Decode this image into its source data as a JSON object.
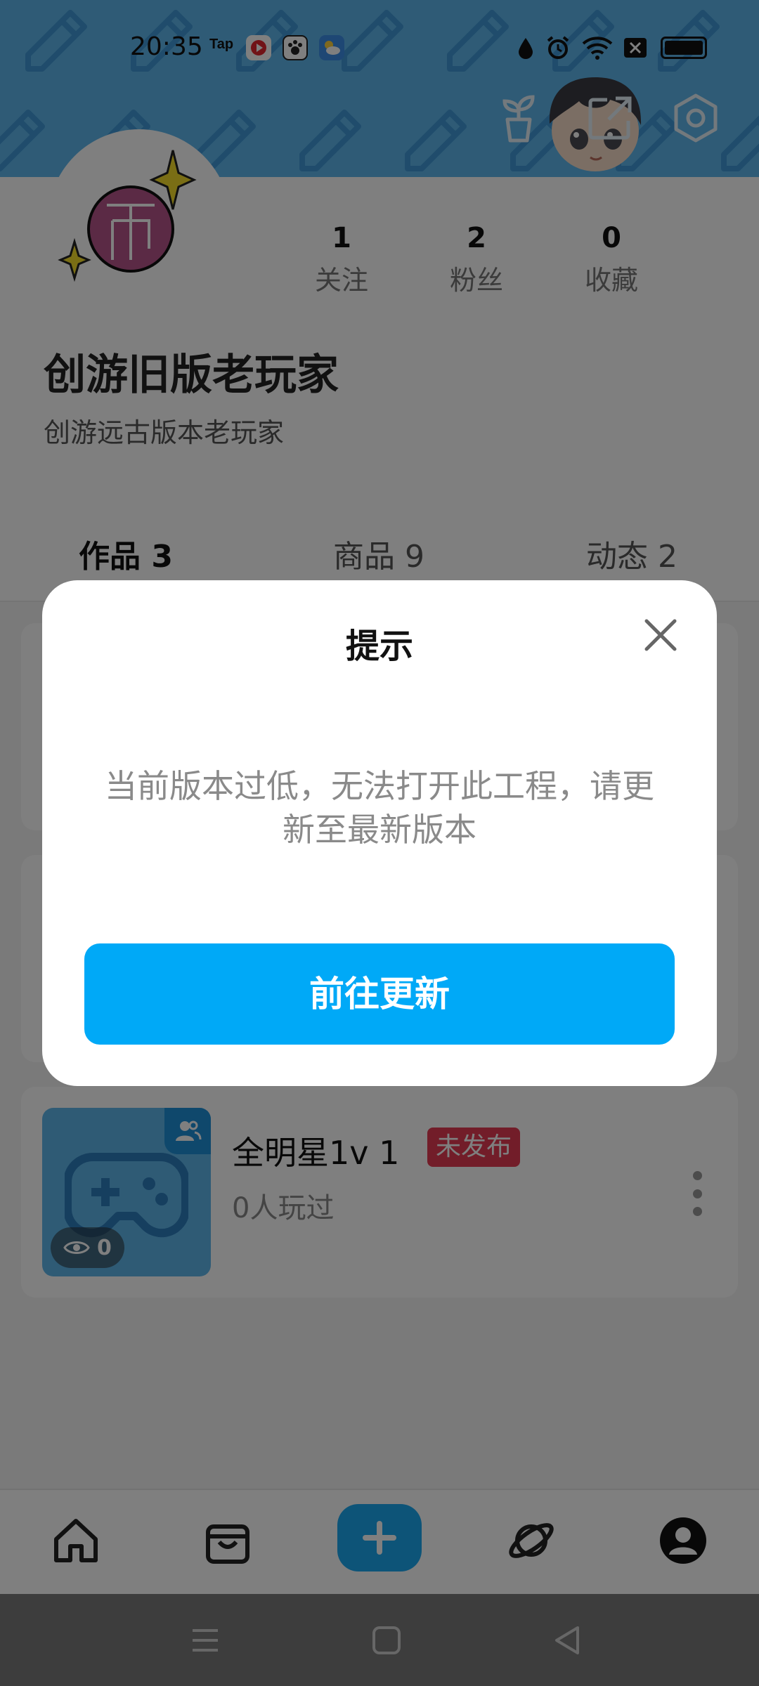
{
  "status_bar": {
    "time": "20:35",
    "tap_label": "Tap"
  },
  "profile": {
    "stats": [
      {
        "value": "1",
        "label": "关注"
      },
      {
        "value": "2",
        "label": "粉丝"
      },
      {
        "value": "0",
        "label": "收藏"
      }
    ],
    "username": "创游旧版老玩家",
    "bio": "创游远古版本老玩家"
  },
  "tabs": [
    {
      "label": "作品 3",
      "active": true
    },
    {
      "label": "商品 9",
      "active": false
    },
    {
      "label": "动态 2",
      "active": false
    }
  ],
  "works": [
    {
      "title": "全明星1v 1",
      "tag": "未发布",
      "sub": "0人玩过",
      "views": "0"
    }
  ],
  "dialog": {
    "title": "提示",
    "message": "当前版本过低，无法打开此工程，请更新至最新版本",
    "button_label": "前往更新"
  },
  "colors": {
    "header_bg": "#5fb7ec",
    "accent": "#00a9f7",
    "tag_red": "#e53b52"
  },
  "icons": {
    "header": [
      "plant-icon",
      "share-icon",
      "settings-icon"
    ],
    "bottom_nav": [
      "home-icon",
      "shop-bag-icon",
      "add-icon",
      "planet-icon",
      "profile-icon"
    ],
    "system_nav": [
      "menu-icon",
      "home-square-icon",
      "back-icon"
    ]
  }
}
